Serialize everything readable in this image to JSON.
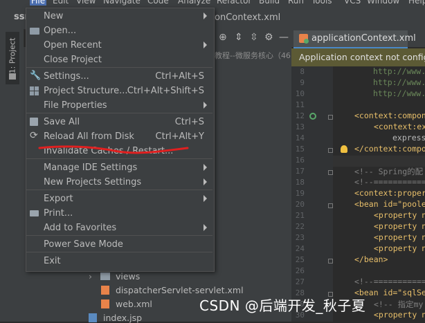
{
  "menubar": {
    "items": [
      "File",
      "Edit",
      "View",
      "Navigate",
      "Code",
      "Analyze",
      "Refactor",
      "Build",
      "Run",
      "Tools",
      "VCS",
      "Window",
      "Help"
    ]
  },
  "project": {
    "name": "ssm",
    "tool_window_label": "1: Project"
  },
  "editor": {
    "breadcrumb_tab": "onContext.xml",
    "active_tab": "applicationContext.xml",
    "notice": "Application context not configu",
    "crumb_text": "教程--微服务核心（46",
    "lines": [
      {
        "n": "8",
        "text": "http://www."
      },
      {
        "n": "9",
        "text": "http://www."
      },
      {
        "n": "10",
        "text": "http://www."
      },
      {
        "n": "11",
        "text": ""
      },
      {
        "n": "12",
        "text": "<context:compon"
      },
      {
        "n": "13",
        "text": "<context:ex"
      },
      {
        "n": "14",
        "text": "express"
      },
      {
        "n": "15",
        "text": "</context:compo"
      },
      {
        "n": "16",
        "text": ""
      },
      {
        "n": "17",
        "text": "<!-- Spring的配"
      },
      {
        "n": "18",
        "text": "<!--============"
      },
      {
        "n": "19",
        "text": "<context:proper"
      },
      {
        "n": "20",
        "text": "<bean id=\"poole"
      },
      {
        "n": "21",
        "text": "<property n"
      },
      {
        "n": "22",
        "text": "<property n"
      },
      {
        "n": "23",
        "text": "<property n"
      },
      {
        "n": "24",
        "text": "<property n"
      },
      {
        "n": "25",
        "text": "</bean>"
      },
      {
        "n": "26",
        "text": ""
      },
      {
        "n": "27",
        "text": "<!--============"
      },
      {
        "n": "28",
        "text": "<bean id=\"sqlSe"
      },
      {
        "n": "29",
        "text": "<!-- 指定my"
      },
      {
        "n": "30",
        "text": "<property n"
      }
    ]
  },
  "file_menu": {
    "items": [
      {
        "label": "New",
        "shortcut": "",
        "submenu": true,
        "icon": ""
      },
      {
        "label": "Open...",
        "shortcut": "",
        "submenu": false,
        "icon": "folder-icon"
      },
      {
        "label": "Open Recent",
        "shortcut": "",
        "submenu": true,
        "icon": ""
      },
      {
        "label": "Close Project",
        "shortcut": "",
        "submenu": false,
        "icon": ""
      },
      {
        "label": "Settings...",
        "shortcut": "Ctrl+Alt+S",
        "submenu": false,
        "icon": "wrench-icon"
      },
      {
        "label": "Project Structure...",
        "shortcut": "Ctrl+Alt+Shift+S",
        "submenu": false,
        "icon": "project-structure-icon"
      },
      {
        "label": "File Properties",
        "shortcut": "",
        "submenu": true,
        "icon": ""
      },
      {
        "label": "Save All",
        "shortcut": "Ctrl+S",
        "submenu": false,
        "icon": "save-icon"
      },
      {
        "label": "Reload All from Disk",
        "shortcut": "Ctrl+Alt+Y",
        "submenu": false,
        "icon": "reload-icon"
      },
      {
        "label": "Invalidate Caches / Restart...",
        "shortcut": "",
        "submenu": false,
        "icon": ""
      },
      {
        "label": "Manage IDE Settings",
        "shortcut": "",
        "submenu": true,
        "icon": ""
      },
      {
        "label": "New Projects Settings",
        "shortcut": "",
        "submenu": true,
        "icon": ""
      },
      {
        "label": "Export",
        "shortcut": "",
        "submenu": true,
        "icon": ""
      },
      {
        "label": "Print...",
        "shortcut": "",
        "submenu": false,
        "icon": "print-icon"
      },
      {
        "label": "Add to Favorites",
        "shortcut": "",
        "submenu": true,
        "icon": ""
      },
      {
        "label": "Power Save Mode",
        "shortcut": "",
        "submenu": false,
        "icon": ""
      },
      {
        "label": "Exit",
        "shortcut": "",
        "submenu": false,
        "icon": ""
      }
    ]
  },
  "tree": {
    "views": "views",
    "dispatcher": "dispatcherServlet-servlet.xml",
    "webxml": "web.xml",
    "indexjsp": "index.jsp"
  },
  "watermark": "CSDN @后端开发_秋子夏",
  "colors": {
    "accent": "#4a88c7",
    "annotation": "#e02020"
  }
}
